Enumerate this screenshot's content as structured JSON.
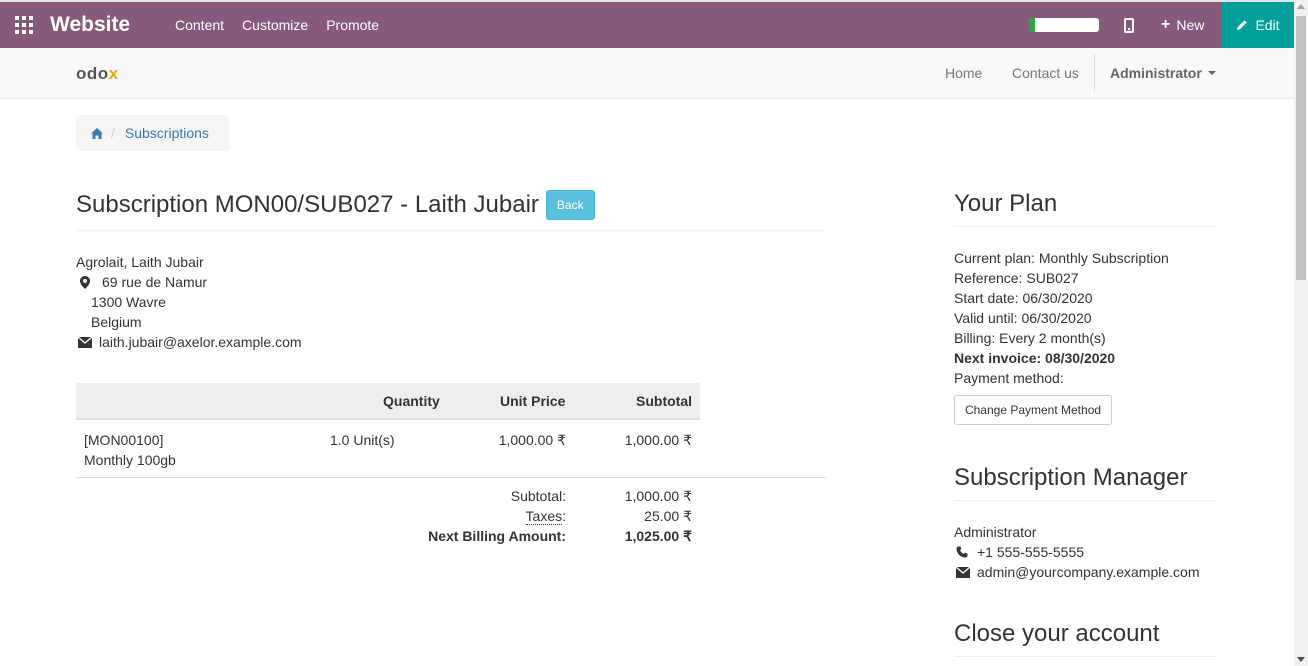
{
  "topbar": {
    "brand": "Website",
    "menu": [
      "Content",
      "Customize",
      "Promote"
    ],
    "new_label": "New",
    "edit_label": "Edit",
    "progress_fraction": 0.08,
    "colors": {
      "bar": "#875A7B",
      "edit": "#00A09D"
    }
  },
  "navbar": {
    "logo_main": "odo",
    "logo_x": "x",
    "home": "Home",
    "contact": "Contact us",
    "user": "Administrator"
  },
  "breadcrumb": {
    "current": "Subscriptions"
  },
  "subscription": {
    "title": "Subscription MON00/SUB027 - Laith Jubair",
    "back_label": "Back",
    "customer": "Agrolait, Laith Jubair",
    "street": "69 rue de Namur",
    "city": "1300 Wavre",
    "country": "Belgium",
    "email": "laith.jubair@axelor.example.com"
  },
  "table": {
    "headers": {
      "quantity": "Quantity",
      "unit_price": "Unit Price",
      "subtotal": "Subtotal"
    },
    "rows": [
      {
        "code": "[MON00100]",
        "name": "Monthly 100gb",
        "quantity": "1.0 Unit(s)",
        "unit_price": "1,000.00 ₹",
        "subtotal": "1,000.00 ₹"
      }
    ],
    "totals": {
      "subtotal_label": "Subtotal:",
      "subtotal": "1,000.00 ₹",
      "taxes_label": "Taxes",
      "taxes_colon": ":",
      "taxes": "25.00 ₹",
      "next_label": "Next Billing Amount:",
      "next": "1,025.00 ₹"
    }
  },
  "plan": {
    "heading": "Your Plan",
    "current": "Current plan: Monthly Subscription",
    "reference": "Reference: SUB027",
    "start": "Start date: 06/30/2020",
    "valid": "Valid until: 06/30/2020",
    "billing": "Billing: Every 2 month(s)",
    "next_invoice": "Next invoice: 08/30/2020",
    "payment": "Payment method:",
    "change_btn": "Change Payment Method"
  },
  "manager": {
    "heading": "Subscription Manager",
    "name": "Administrator",
    "phone": "+1 555-555-5555",
    "email": "admin@yourcompany.example.com"
  },
  "close": {
    "heading": "Close your account"
  }
}
